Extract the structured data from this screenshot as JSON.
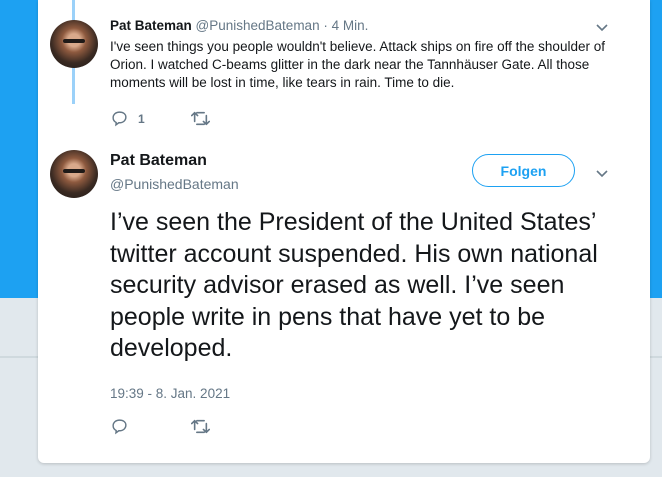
{
  "reply_tweet": {
    "author_name": "Pat Bateman",
    "author_handle": "@PunishedBateman",
    "separator": "·",
    "time": "4 Min.",
    "text": "I've seen things you people wouldn't believe. Attack ships on fire off the shoulder of Orion. I watched C-beams glitter in the dark near the Tannhäuser Gate. All those moments will be lost in time, like tears in rain. Time to die.",
    "reply_count": "1",
    "icons": {
      "avatar": "profile-photo",
      "menu": "chevron-down-icon",
      "reply": "reply-icon",
      "retweet": "retweet-icon"
    }
  },
  "main_tweet": {
    "author_name": "Pat Bateman",
    "author_handle": "@PunishedBateman",
    "follow_label": "Folgen",
    "text": "I’ve seen the President of the United States’ twitter account suspended. His own national security advisor erased as well. I’ve seen people write in pens that have yet to be developed.",
    "timestamp": "19:39 - 8. Jan. 2021",
    "icons": {
      "avatar": "profile-photo",
      "menu": "chevron-down-icon",
      "reply": "reply-icon",
      "retweet": "retweet-icon"
    }
  },
  "colors": {
    "accent": "#1da1f2",
    "thread_line": "#9bd1f9",
    "secondary_text": "#657786",
    "primary_text": "#14171a"
  }
}
